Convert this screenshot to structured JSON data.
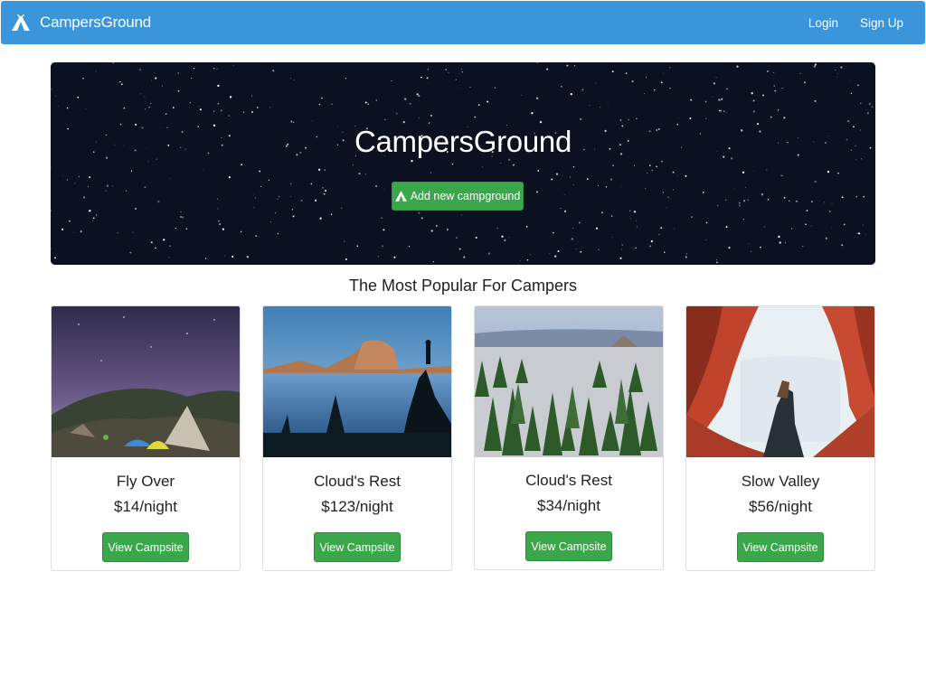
{
  "navbar": {
    "brand": "CampersGround",
    "brand_icon": "tent-icon",
    "login_label": "Login",
    "signup_label": "Sign Up",
    "bg_color": "#3a95db"
  },
  "jumbotron": {
    "title": "CampersGround",
    "add_button_label": "Add new campground",
    "add_button_icon": "tent-icon"
  },
  "section_heading": "The Most Popular For Campers",
  "cards": [
    {
      "title": "Fly Over",
      "price": "$14/night",
      "button_label": "View Campsite"
    },
    {
      "title": "Cloud's Rest",
      "price": "$123/night",
      "button_label": "View Campsite"
    },
    {
      "title": "Cloud's Rest",
      "price": "$34/night",
      "button_label": "View Campsite"
    },
    {
      "title": "Slow Valley",
      "price": "$56/night",
      "button_label": "View Campsite"
    }
  ],
  "colors": {
    "primary": "#3a95db",
    "success": "#3aa84a"
  }
}
